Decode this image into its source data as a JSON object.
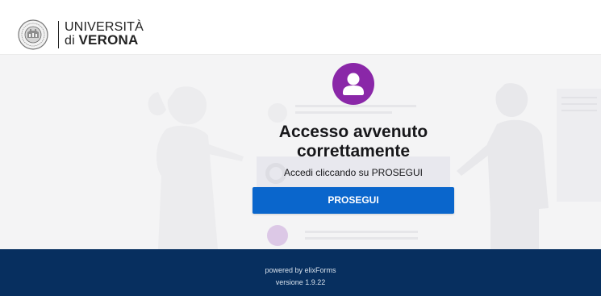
{
  "header": {
    "university_line1": "UNIVERSITÀ",
    "university_di": "di",
    "university_name": "VERONA"
  },
  "main": {
    "title_line1": "Accesso avvenuto",
    "title_line2": "correttamente",
    "subtitle": "Accedi cliccando su PROSEGUI",
    "button_label": "PROSEGUI"
  },
  "footer": {
    "powered_by": "powered by elixForms",
    "version": "versione 1.9.22"
  },
  "colors": {
    "accent_purple": "#8a27a8",
    "button_blue": "#0a66cc",
    "footer_navy": "#072f5f",
    "background": "#f4f4f5"
  },
  "icons": [
    "university-seal-icon",
    "user-avatar-icon"
  ]
}
